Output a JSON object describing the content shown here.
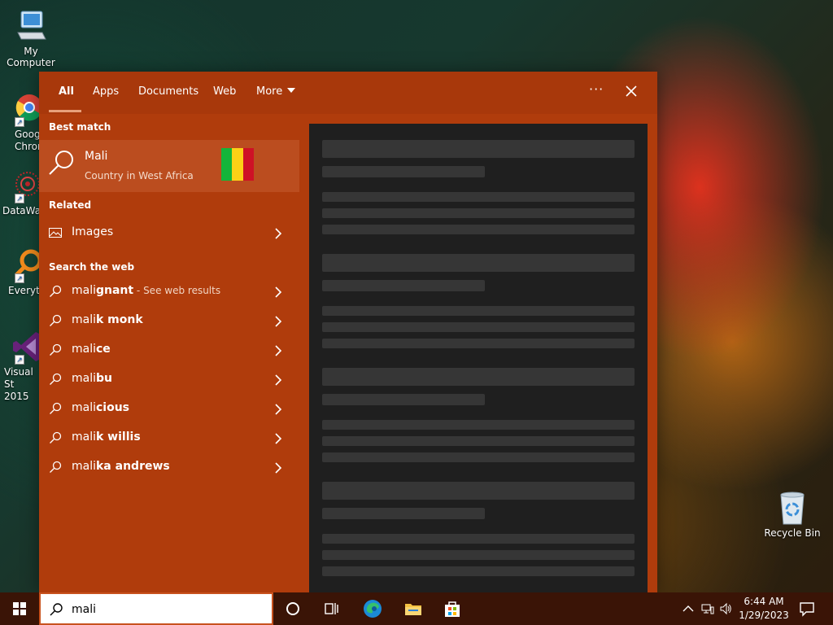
{
  "desktop": {
    "icons": [
      {
        "label": "My Computer"
      },
      {
        "label": "Goog Chron"
      },
      {
        "label": "DataWag"
      },
      {
        "label": "Everyth"
      },
      {
        "label": "Visual St 2015"
      },
      {
        "label": "Recycle Bin"
      }
    ]
  },
  "search_panel": {
    "tabs": [
      {
        "label": "All",
        "active": true
      },
      {
        "label": "Apps"
      },
      {
        "label": "Documents"
      },
      {
        "label": "Web"
      },
      {
        "label": "More"
      }
    ],
    "more_options_label": "···",
    "best_match_heading": "Best match",
    "best_match": {
      "title": "Mali",
      "subtitle": "Country in West Africa",
      "flag_colors": [
        "#14b53a",
        "#fcd116",
        "#ce1126"
      ]
    },
    "related_heading": "Related",
    "related": [
      {
        "label": "Images",
        "icon": "image-icon"
      }
    ],
    "web_heading": "Search the web",
    "web_results": [
      {
        "typed": "mali",
        "rest": "gnant",
        "hint": " - See web results"
      },
      {
        "typed": "mali",
        "rest": "k monk",
        "hint": ""
      },
      {
        "typed": "mali",
        "rest": "ce",
        "hint": ""
      },
      {
        "typed": "mali",
        "rest": "bu",
        "hint": ""
      },
      {
        "typed": "mali",
        "rest": "cious",
        "hint": ""
      },
      {
        "typed": "mali",
        "rest": "k willis",
        "hint": ""
      },
      {
        "typed": "mali",
        "rest": "ka andrews",
        "hint": ""
      }
    ]
  },
  "taskbar": {
    "search_value": "mali",
    "time": "6:44 AM",
    "date": "1/29/2023"
  },
  "colors": {
    "accent": "#b03c0c",
    "tab_bar": "#a8380b",
    "best_match_bg": "#bb4d1f",
    "preview_bg": "#1f1f1f",
    "taskbar": "#3a1406"
  }
}
